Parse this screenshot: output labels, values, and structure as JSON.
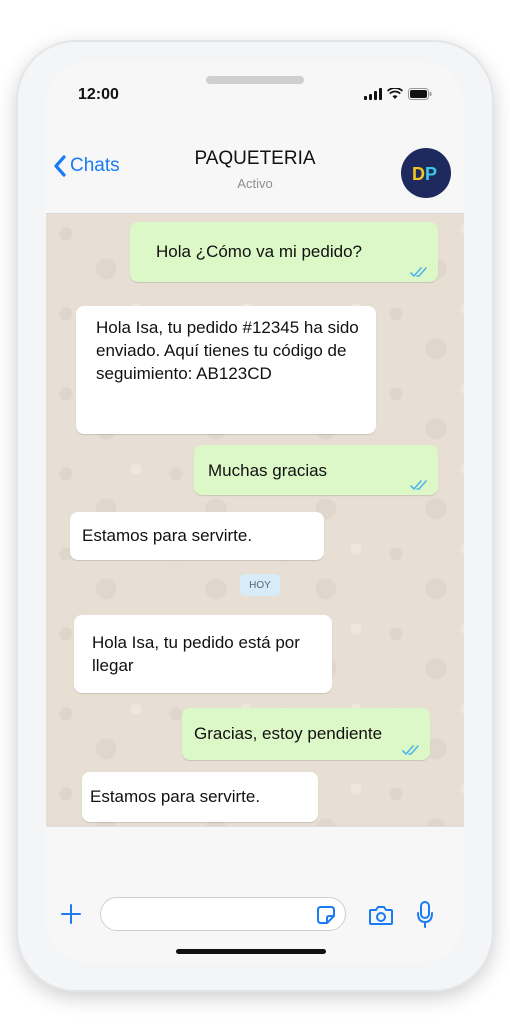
{
  "status_bar": {
    "time": "12:00"
  },
  "header": {
    "back_label": "Chats",
    "contact_name": "PAQUETERIA",
    "contact_status": "Activo",
    "avatar_text": "DP"
  },
  "messages": [
    {
      "direction": "outgoing",
      "text": "Hola ¿Cómo va mi pedido?",
      "read": true
    },
    {
      "direction": "incoming",
      "text": "Hola Isa, tu pedido #12345 ha sido enviado. Aquí tienes tu código de seguimiento: AB123CD"
    },
    {
      "direction": "outgoing",
      "text": "Muchas gracias",
      "read": true
    },
    {
      "direction": "incoming",
      "text": "Estamos para servirte."
    },
    {
      "direction": "incoming",
      "text": "Hola Isa, tu pedido está por llegar"
    },
    {
      "direction": "outgoing",
      "text": "Gracias, estoy pendiente",
      "read": true
    },
    {
      "direction": "incoming",
      "text": "Estamos para servirte."
    }
  ],
  "date_separator": "HOY",
  "input_bar": {
    "placeholder": ""
  },
  "colors": {
    "accent": "#1a7cf5",
    "outgoing_bubble": "#dcf8c6",
    "incoming_bubble": "#ffffff",
    "read_ticks": "#4fb6ec",
    "chat_background": "#e7dfd3"
  },
  "icons": [
    "chevron-left-icon",
    "signal-icon",
    "wifi-icon",
    "battery-icon",
    "plus-icon",
    "sticker-icon",
    "camera-icon",
    "microphone-icon",
    "double-check-icon"
  ]
}
